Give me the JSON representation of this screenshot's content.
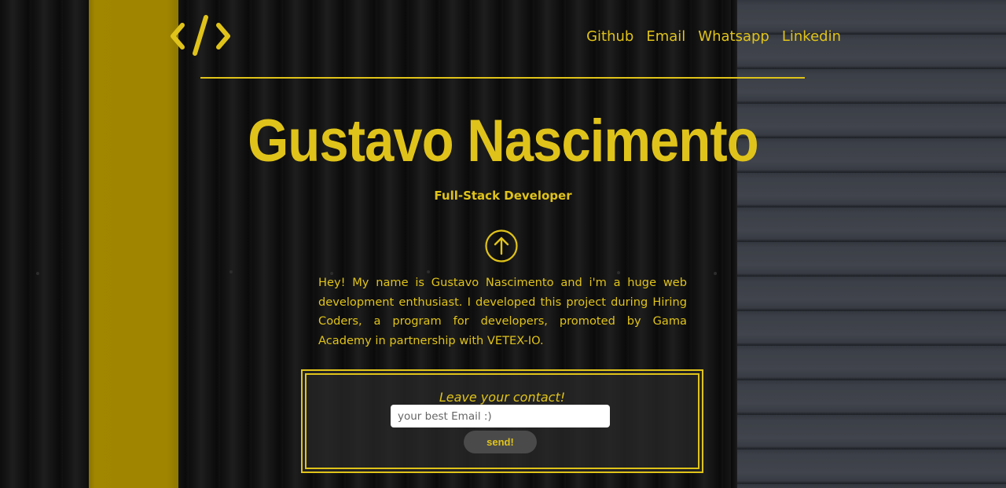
{
  "brand": {
    "logo_icon": "code-brackets-icon",
    "accent_color": "#e0c31a"
  },
  "nav": {
    "items": [
      {
        "label": "Github"
      },
      {
        "label": "Email"
      },
      {
        "label": "Whatsapp"
      },
      {
        "label": "Linkedin"
      }
    ]
  },
  "hero": {
    "title": "Gustavo Nascimento",
    "subtitle": "Full-Stack Developer",
    "scroll_icon": "arrow-up-circle-icon"
  },
  "intro": {
    "text": "Hey! My name is Gustavo Nascimento and i'm a huge web development enthusiast. I developed this project during Hiring Coders, a program for developers, promoted by Gama Academy in partnership with VETEX-IO."
  },
  "contact": {
    "heading": "Leave your contact!",
    "email_placeholder": "your best Email :)",
    "send_label": "send!"
  }
}
